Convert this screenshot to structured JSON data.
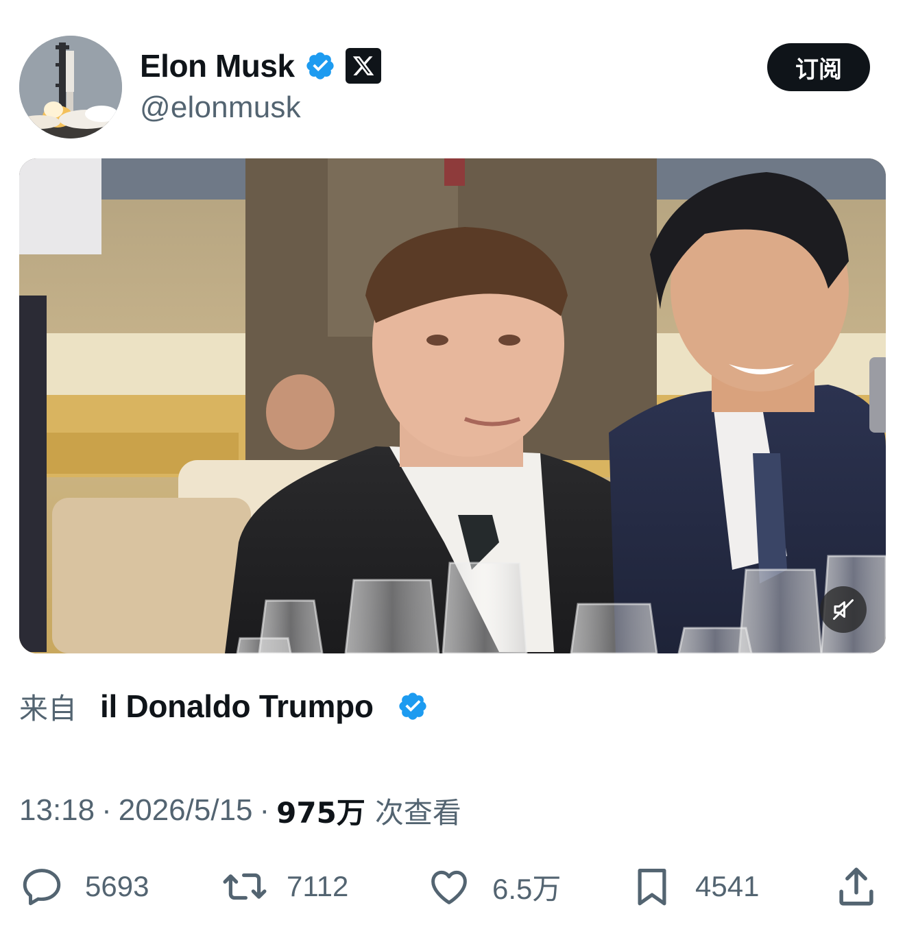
{
  "author": {
    "display_name": "Elon Musk",
    "handle": "@elonmusk",
    "avatar_icon": "rocket-launch-avatar",
    "verified_color": "#1d9bf0",
    "affiliate_badge_icon": "x-logo-icon"
  },
  "header": {
    "subscribe_label": "订阅"
  },
  "media": {
    "type": "video",
    "mute_icon": "muted-speaker-icon"
  },
  "attribution": {
    "prefix": "来自",
    "source_name": "il Donaldo Trumpo"
  },
  "meta": {
    "time": "13:18",
    "separator": "·",
    "date": "2026/5/15",
    "views_count": "975万",
    "views_label": "次查看"
  },
  "actions": {
    "replies": "5693",
    "reposts": "7112",
    "likes": "6.5万",
    "bookmarks": "4541"
  },
  "colors": {
    "text_primary": "#0f1419",
    "text_secondary": "#536471",
    "accent_blue": "#1d9bf0"
  }
}
